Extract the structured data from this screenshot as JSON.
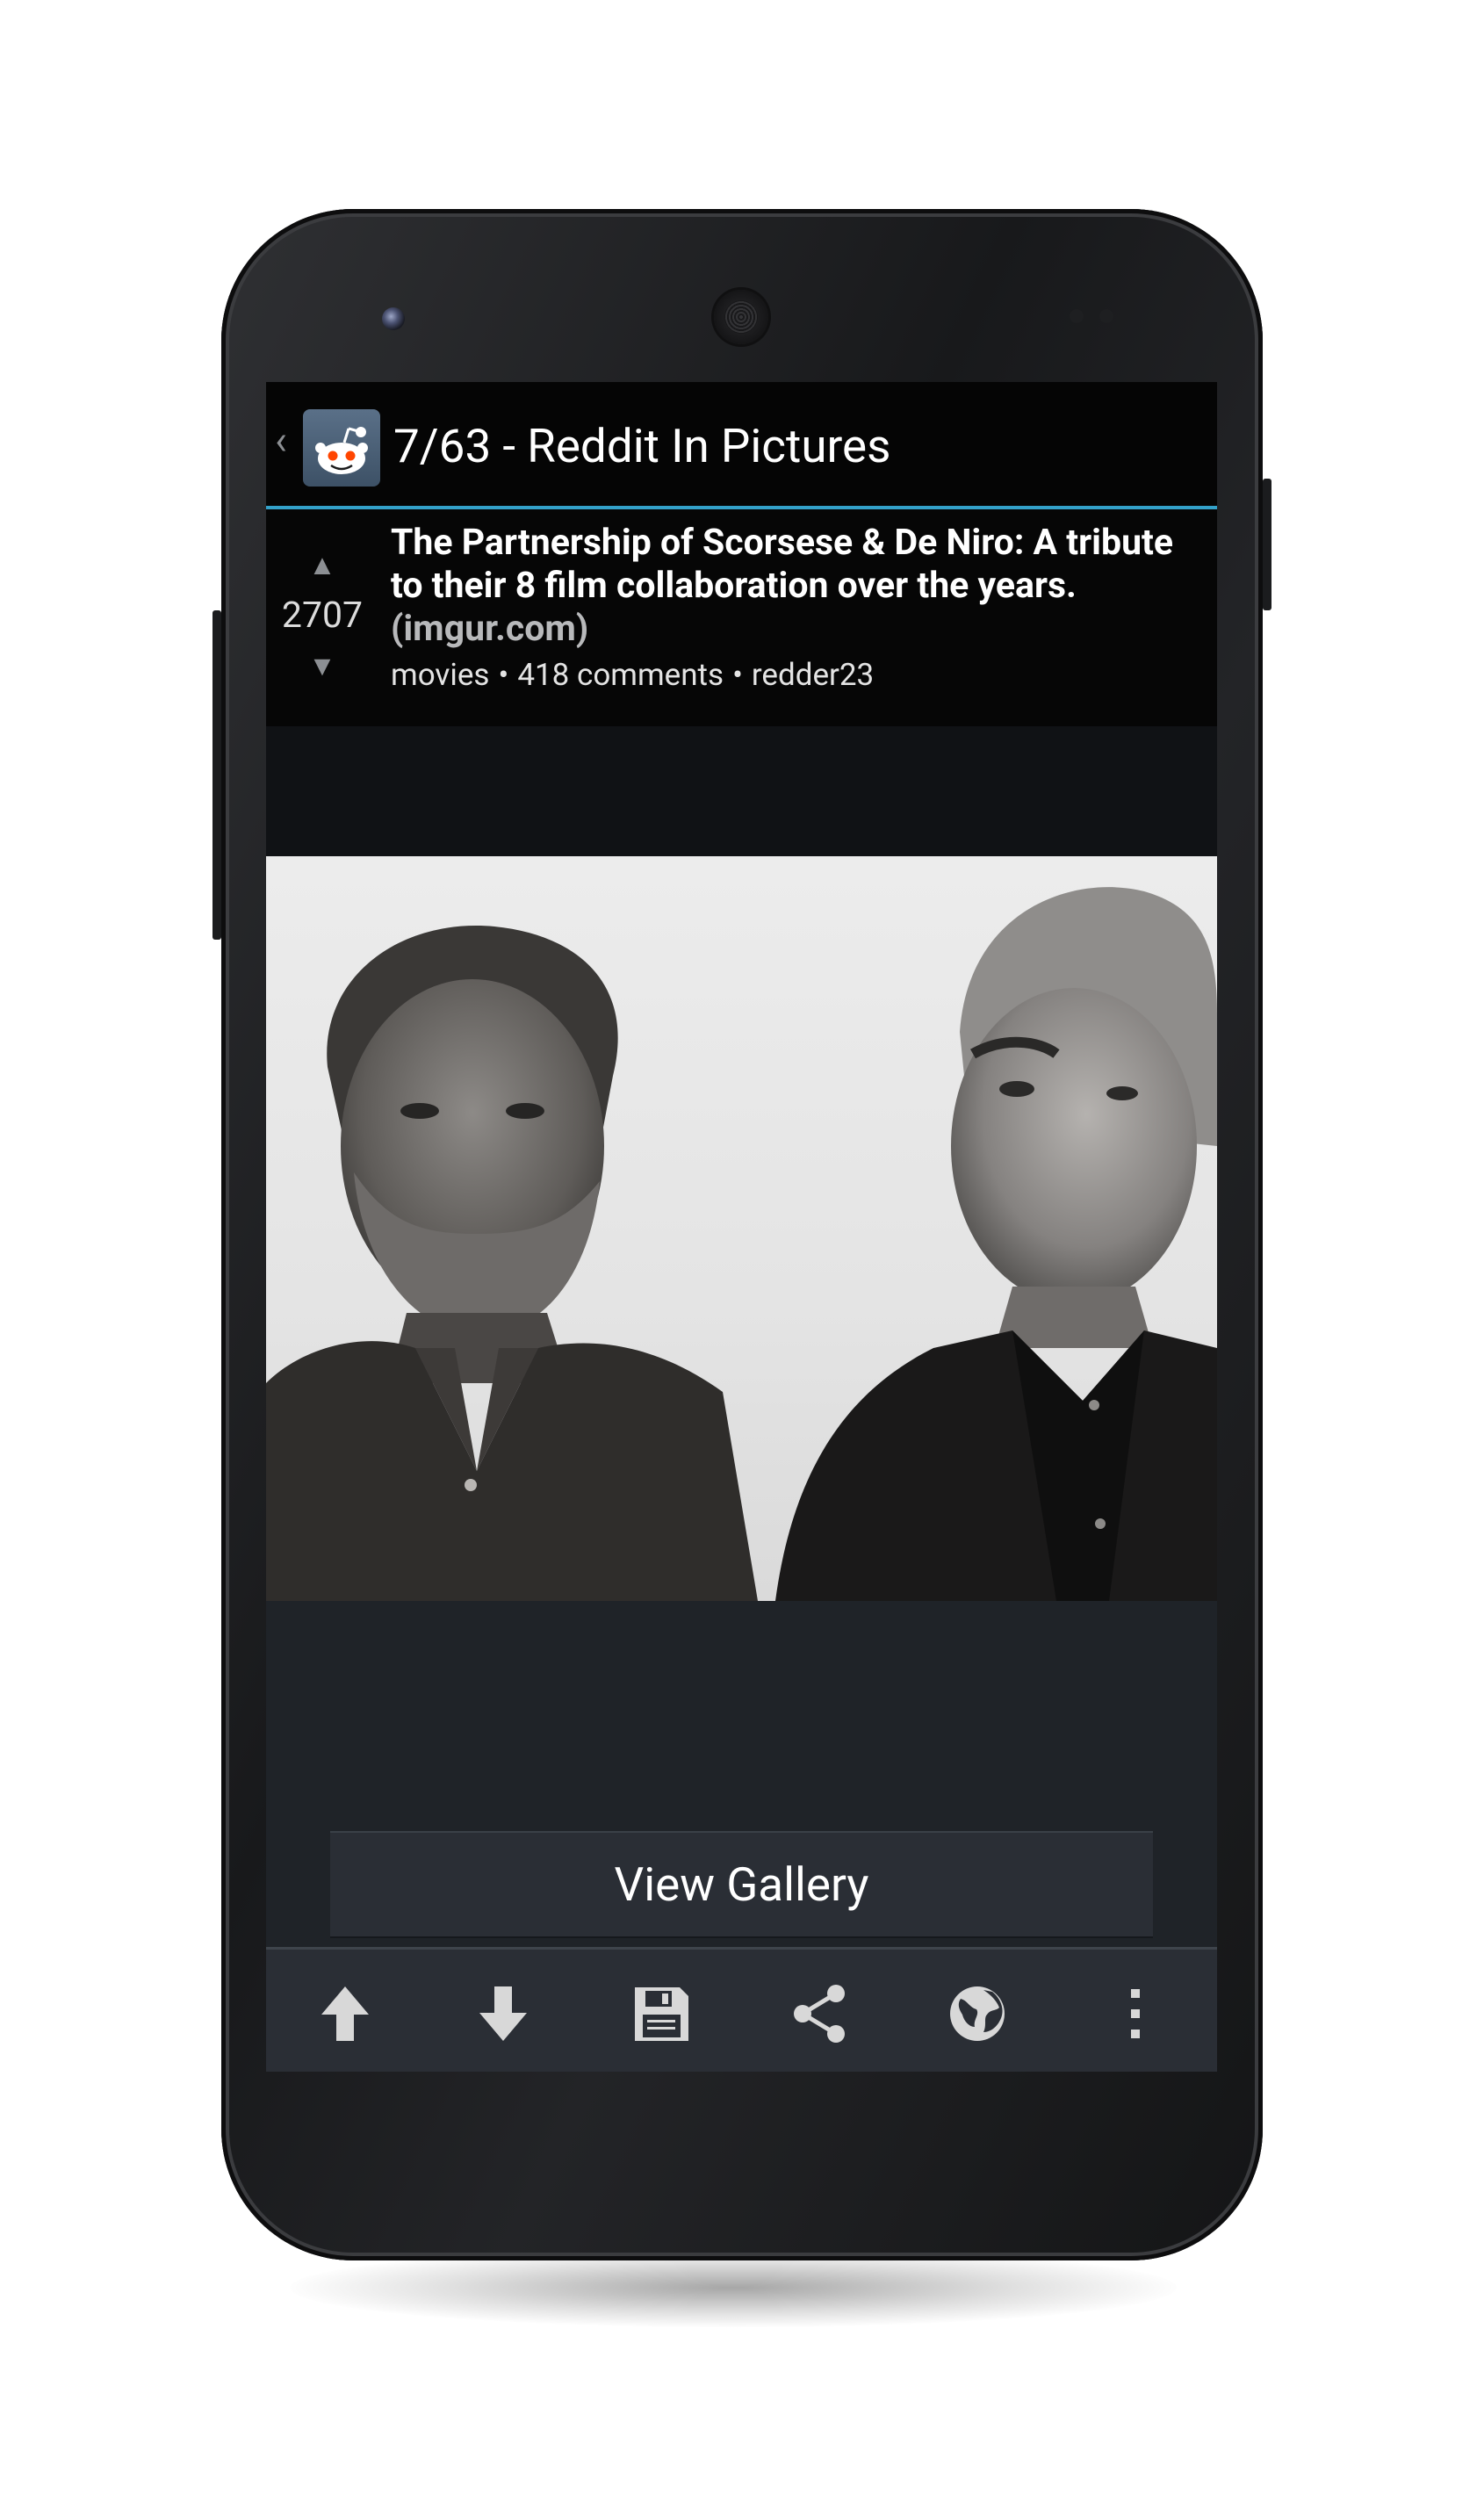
{
  "action_bar": {
    "title": "7/63 - Reddit In Pictures",
    "up_caret": "‹",
    "app_icon": "reddit-alien-icon"
  },
  "post": {
    "score": "2707",
    "title": "The Partnership of Scorsese & De Niro: A tribute to their 8 film collaboration over the years.",
    "domain": "(imgur.com)",
    "subreddit": "movies",
    "separator": "•",
    "comments": "418 comments",
    "author": "redder23"
  },
  "content": {
    "view_gallery_label": "View Gallery"
  },
  "bottom_bar": {
    "actions": [
      "arrow-up-icon",
      "arrow-down-icon",
      "save-floppy-icon",
      "share-icon",
      "globe-icon",
      "overflow-menu-icon"
    ]
  },
  "colors": {
    "accent": "#33a1c9",
    "action_bar_bg": "#050505",
    "screen_bg": "#1f2328",
    "bar_bg": "#2a2e35"
  }
}
